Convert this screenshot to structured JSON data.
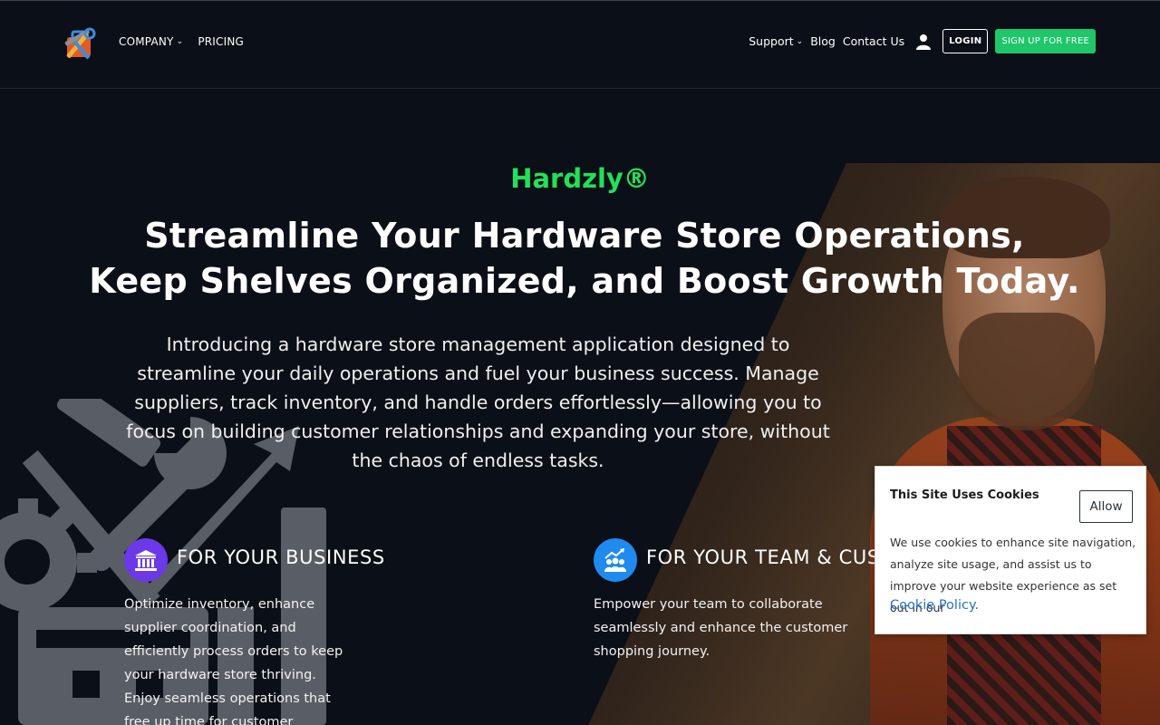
{
  "header": {
    "nav_left": [
      {
        "label": "COMPANY",
        "has_dropdown": true
      },
      {
        "label": "PRICING",
        "has_dropdown": false
      }
    ],
    "nav_right": {
      "support": "Support",
      "blog": "Blog",
      "contact": "Contact Us",
      "login": "LOGIN",
      "signup": "SIGN UP FOR FREE"
    }
  },
  "hero": {
    "brand": "Hardzly®",
    "headline_line1": "Streamline Your Hardware Store Operations,",
    "headline_line2": "Keep Shelves Organized, and Boost Growth Today.",
    "intro": "Introducing a hardware store management application designed to streamline your daily operations and fuel your business success. Manage suppliers, track inventory, and handle orders effortlessly—allowing you to focus on building customer relationships and expanding your store, without the chaos of endless tasks."
  },
  "features": [
    {
      "title": "FOR YOUR BUSINESS",
      "text": "Optimize inventory, enhance supplier coordination, and efficiently process orders to keep your hardware store thriving. Enjoy seamless operations that free up time for customer engagement and"
    },
    {
      "title": "FOR YOUR TEAM & CUS",
      "text": "Empower your team to collaborate seamlessly and enhance the customer shopping journey."
    }
  ],
  "cookie": {
    "title": "This Site Uses Cookies",
    "allow": "Allow",
    "text": "We use cookies to enhance site navigation, analyze site usage, and assist us to improve your website experience as set out in our",
    "link": "Cookie Policy."
  },
  "colors": {
    "background": "#0b0f17",
    "brand_green": "#22e05a",
    "signup_green": "#1fc66a",
    "business_icon": "#6b39e8",
    "team_icon": "#1f8bef",
    "link_blue": "#2372c9"
  }
}
